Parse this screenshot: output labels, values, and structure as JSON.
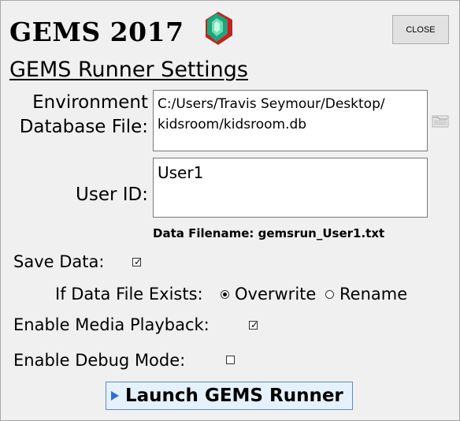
{
  "header": {
    "app_title": "GEMS 2017",
    "close_label": "CLOSE",
    "gem_colors": {
      "emerald": "#1fa57a",
      "ruby": "#c8201e"
    }
  },
  "settings": {
    "heading": "GEMS Runner Settings",
    "env_db_label_line1": "Environment",
    "env_db_label_line2": "Database File:",
    "env_db_value_line1": "C:/Users/Travis Seymour/Desktop/",
    "env_db_value_line2": "kidsroom/kidsroom.db",
    "browse_icon": "folder-icon",
    "user_id_label": "User ID:",
    "user_id_value": "User1",
    "data_filename": "Data Filename: gemsrun_User1.txt"
  },
  "options": {
    "save_data_label": "Save Data:",
    "save_data_checked": true,
    "file_exists_label": "If Data File Exists:",
    "overwrite_label": "Overwrite",
    "rename_label": "Rename",
    "file_exists_selected": "Overwrite",
    "media_playback_label": "Enable Media Playback:",
    "media_playback_checked": true,
    "debug_mode_label": "Enable Debug Mode:",
    "debug_mode_checked": false
  },
  "actions": {
    "launch_label": "Launch GEMS Runner",
    "launch_icon": "play-icon",
    "accent": "#2f6fd6"
  }
}
